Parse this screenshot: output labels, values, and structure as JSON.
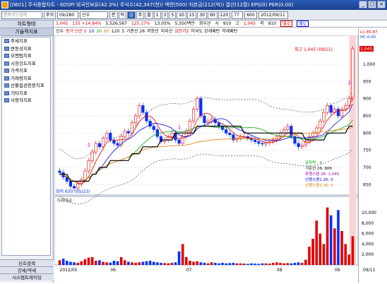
{
  "title": "[0601] 주식종합차트 - KOSPI 외국인보유(42.3%) 주식수(42,347(천)) 액면(500) 자본금(212(억)) 결산(12월) EPS(0) PER(0.00)",
  "window_buttons": [
    "_",
    "□",
    "×"
  ],
  "toolbar": {
    "code_input": "종목코드입력",
    "stock_btn": "주식",
    "period_input": "09/280",
    "name_input": "신우",
    "unit_buttons": [
      "분",
      "틱",
      "일",
      "주",
      "월",
      "1",
      "3",
      "5",
      "10",
      "15",
      "30",
      "60",
      "120"
    ],
    "range_input": "77",
    "total_input": "600",
    "date": "2012/09/11"
  },
  "quote": {
    "price": "1,045",
    "change": "135 +14.84%",
    "volume": "5,526,567",
    "vol_pct": "125.17%",
    "turnover": "13.05%",
    "amount": "5,550백만",
    "avg_label": "회우선",
    "s_label": "시",
    "s_val": "910",
    "h_label": "고",
    "h_val": "1,045",
    "l_label": "저",
    "l_val": "910",
    "buy": "매수",
    "sell": "매도"
  },
  "legend": [
    {
      "t": "신우",
      "c": "#000"
    },
    {
      "t": "종가 단순 5",
      "c": "#e00000"
    },
    {
      "t": "10",
      "c": "#0000e0"
    },
    {
      "t": "20",
      "c": "#00a000"
    },
    {
      "t": "60",
      "c": "#e08000"
    },
    {
      "t": "120",
      "c": "#000"
    },
    {
      "t": "3",
      "c": "#000"
    },
    {
      "t": "기준선 26",
      "c": "#000"
    },
    {
      "t": "저항선",
      "c": "#000"
    },
    {
      "t": "지지선",
      "c": "#000"
    },
    {
      "t": "상한가2",
      "c": "#e00000"
    },
    {
      "t": "미국도 강세패턴",
      "c": "#000"
    },
    {
      "t": "약세패턴",
      "c": "#000"
    }
  ],
  "sidebar": {
    "header": "차트형태",
    "tab": "기술적지표",
    "items": [
      "추세지표",
      "변동성지표",
      "모멘텀지표",
      "시장강도지표",
      "가격지표",
      "거래량지표",
      "선물옵션전용지표",
      "기타지표",
      "사용자지표"
    ],
    "bottom": [
      "신호검색",
      "강세/약세",
      "시스템트레이딩"
    ]
  },
  "chart_data": {
    "type": "candlestick",
    "price_axis": {
      "ticks": [
        1000,
        950,
        900,
        850,
        800,
        750,
        700,
        650
      ],
      "min": 620,
      "max": 1080
    },
    "volume_axis": {
      "ticks": [
        "10,000",
        "8,000",
        "6,000",
        "4,000",
        "2,000"
      ],
      "max": 11500
    },
    "x_labels": [
      "2012/05",
      "06",
      "07",
      "08",
      "09"
    ],
    "last_price_tag": "1,045",
    "right_header": [
      "LC:85.87",
      "HC:0.00"
    ],
    "right_bottom": "09/11",
    "high_label": "최고 1,045 (09/11)",
    "low_label": "최저 630 (05/23)",
    "info_lines": [
      {
        "t": "감하락 : 0",
        "c": "#00a000"
      },
      {
        "t": "기준선 26: 806",
        "c": "#000"
      },
      {
        "t": "후행스팬 26: 1,045",
        "c": "#a000a0"
      },
      {
        "t": "선행스팬1 26: 0",
        "c": "#0000e0"
      },
      {
        "t": "선행스팬2 26: 0",
        "c": "#e08000"
      }
    ],
    "volume_label": "거래대금",
    "closes": [
      685,
      672,
      660,
      645,
      640,
      652,
      665,
      690,
      720,
      745,
      770,
      760,
      785,
      800,
      780,
      770,
      765,
      790,
      805,
      800,
      830,
      850,
      880,
      860,
      835,
      820,
      810,
      790,
      775,
      780,
      790,
      800,
      780,
      770,
      790,
      805,
      835,
      870,
      900,
      850,
      830,
      835,
      840,
      830,
      820,
      810,
      800,
      795,
      780,
      785,
      790,
      790,
      785,
      780,
      775,
      770,
      768,
      772,
      775,
      780,
      790,
      800,
      810,
      820,
      790,
      770,
      760,
      765,
      775,
      790,
      800,
      815,
      835,
      860,
      880,
      860,
      870,
      850,
      870,
      880,
      900,
      1045
    ],
    "volumes": [
      900,
      1200,
      800,
      600,
      500,
      400,
      700,
      1100,
      1400,
      1500,
      800,
      900,
      600,
      500,
      450,
      800,
      700,
      1500,
      900,
      600,
      500,
      400,
      500,
      600,
      700,
      800,
      600,
      500,
      400,
      350,
      300,
      400,
      500,
      2600,
      4000,
      1500,
      800,
      600,
      700,
      500,
      400,
      300,
      500,
      400,
      300,
      400,
      300,
      350,
      400,
      300,
      300,
      250,
      200,
      300,
      250,
      200,
      300,
      300,
      250,
      400,
      500,
      400,
      300,
      350,
      300,
      400,
      500,
      400,
      1000,
      3500,
      5000,
      8500,
      6000,
      4000,
      11000,
      9500,
      7000,
      10500,
      6500,
      4000,
      2000,
      5500
    ]
  }
}
